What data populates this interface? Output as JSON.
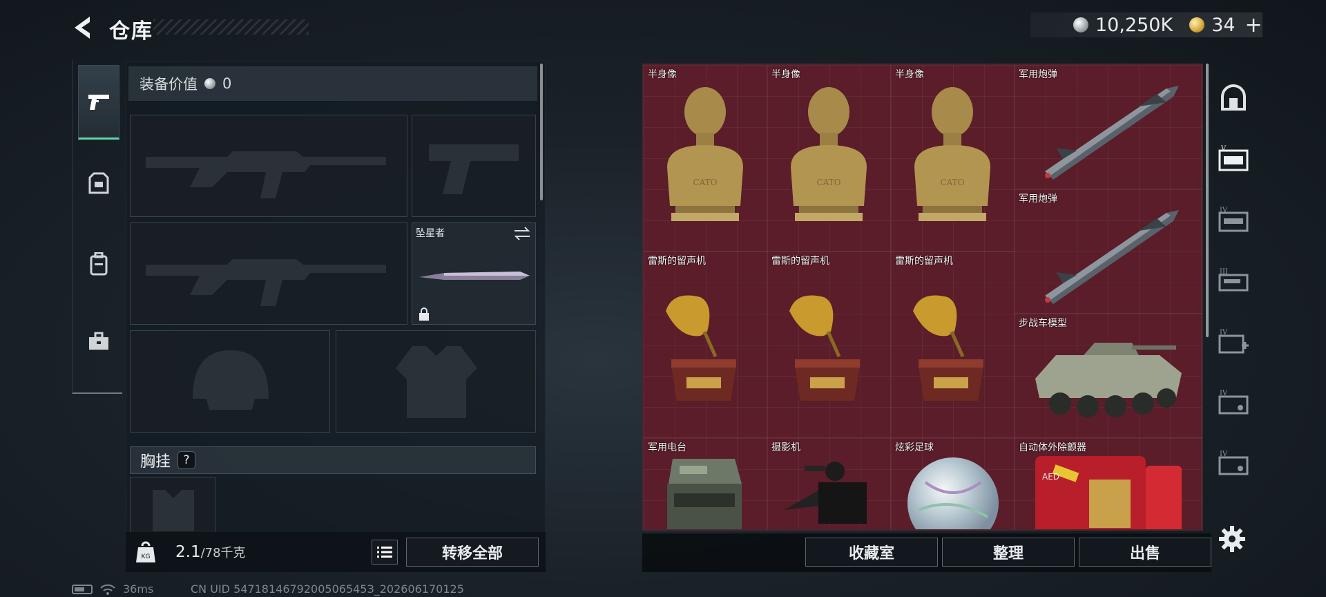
{
  "header": {
    "title": "仓库",
    "currency_silver": "10,250K",
    "currency_gold": "34"
  },
  "categories": [
    {
      "icon": "pistol-icon",
      "active": true
    },
    {
      "icon": "armor-icon",
      "active": false
    },
    {
      "icon": "backpack-icon",
      "active": false
    },
    {
      "icon": "toolbox-icon",
      "active": false
    }
  ],
  "equipment": {
    "value_label": "装备价值",
    "value": "0",
    "melee_name": "坠星者",
    "chest_rig_label": "胸挂",
    "chest_rig_help": "?"
  },
  "weight": {
    "current": "2.1",
    "max": "/78千克",
    "icon_text": "KG"
  },
  "transfer_all_label": "转移全部",
  "warehouse": {
    "items": [
      {
        "name": "半身像",
        "icon": "bust-icon"
      },
      {
        "name": "半身像",
        "icon": "bust-icon"
      },
      {
        "name": "半身像",
        "icon": "bust-icon"
      },
      {
        "name": "军用炮弹",
        "icon": "missile-icon"
      },
      {
        "name": "军用炮弹",
        "icon": "missile-icon"
      },
      {
        "name": "雷斯的留声机",
        "icon": "gramophone-icon"
      },
      {
        "name": "雷斯的留声机",
        "icon": "gramophone-icon"
      },
      {
        "name": "雷斯的留声机",
        "icon": "gramophone-icon"
      },
      {
        "name": "步战车模型",
        "icon": "ifv-model-icon"
      },
      {
        "name": "军用电台",
        "icon": "radio-icon"
      },
      {
        "name": "摄影机",
        "icon": "camera-icon"
      },
      {
        "name": "炫彩足球",
        "icon": "football-icon"
      },
      {
        "name": "自动体外除颤器",
        "icon": "aed-icon"
      }
    ],
    "bust_text": "CATO",
    "aed_text": "AED"
  },
  "filters": [
    {
      "icon": "helmet-filter-icon",
      "tier": ""
    },
    {
      "icon": "weapon-chest-filter-icon",
      "tier": "V"
    },
    {
      "icon": "weapon-case-filter-icon",
      "tier": "IV"
    },
    {
      "icon": "ammo-box-filter-icon",
      "tier": "III"
    },
    {
      "icon": "medkit-filter-icon",
      "tier": "IV"
    },
    {
      "icon": "item-case-filter-icon",
      "tier": "IV"
    },
    {
      "icon": "item-case-filter-icon",
      "tier": "IV"
    }
  ],
  "actions": {
    "collection": "收藏室",
    "organize": "整理",
    "sell": "出售"
  },
  "status": {
    "ping": "36ms",
    "uid": "CN UID 5471814679200506545З_202606170125"
  },
  "colors": {
    "accent_green": "#5fd8a8",
    "grid_red": "#5a1d29",
    "panel_dark": "#141a1f"
  }
}
